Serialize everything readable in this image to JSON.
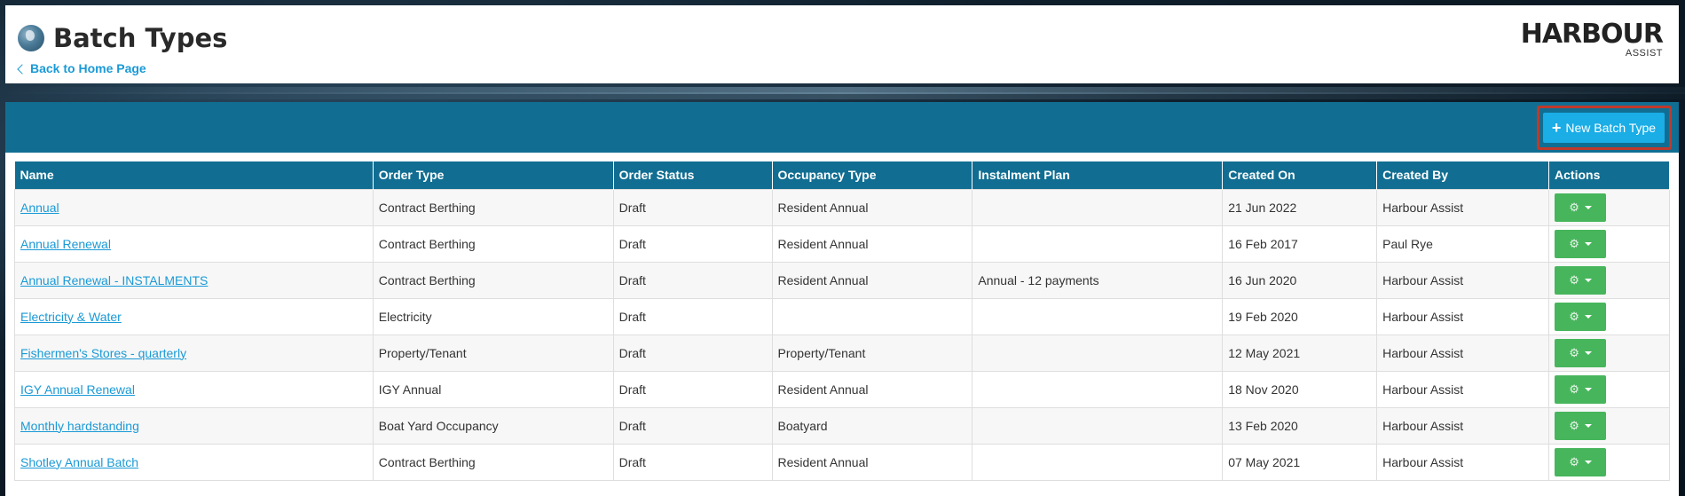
{
  "header": {
    "title": "Batch Types",
    "back_link": "Back to Home Page",
    "logo_main": "HARBOUR",
    "logo_sub": "ASSIST"
  },
  "toolbar": {
    "new_button_label": "New Batch Type"
  },
  "table": {
    "columns": [
      "Name",
      "Order Type",
      "Order Status",
      "Occupancy Type",
      "Instalment Plan",
      "Created On",
      "Created By",
      "Actions"
    ],
    "rows": [
      {
        "name": "Annual",
        "order_type": "Contract Berthing",
        "order_status": "Draft",
        "occupancy_type": "Resident Annual",
        "instalment_plan": "",
        "created_on": "21 Jun 2022",
        "created_by": "Harbour Assist"
      },
      {
        "name": "Annual Renewal",
        "order_type": "Contract Berthing",
        "order_status": "Draft",
        "occupancy_type": "Resident Annual",
        "instalment_plan": "",
        "created_on": "16 Feb 2017",
        "created_by": "Paul Rye"
      },
      {
        "name": "Annual Renewal - INSTALMENTS",
        "order_type": "Contract Berthing",
        "order_status": "Draft",
        "occupancy_type": "Resident Annual",
        "instalment_plan": "Annual - 12 payments",
        "created_on": "16 Jun 2020",
        "created_by": "Harbour Assist"
      },
      {
        "name": "Electricity & Water",
        "order_type": "Electricity",
        "order_status": "Draft",
        "occupancy_type": "",
        "instalment_plan": "",
        "created_on": "19 Feb 2020",
        "created_by": "Harbour Assist"
      },
      {
        "name": "Fishermen's Stores - quarterly",
        "order_type": "Property/Tenant",
        "order_status": "Draft",
        "occupancy_type": "Property/Tenant",
        "instalment_plan": "",
        "created_on": "12 May 2021",
        "created_by": "Harbour Assist"
      },
      {
        "name": "IGY Annual Renewal",
        "order_type": "IGY Annual",
        "order_status": "Draft",
        "occupancy_type": "Resident Annual",
        "instalment_plan": "",
        "created_on": "18 Nov 2020",
        "created_by": "Harbour Assist"
      },
      {
        "name": "Monthly hardstanding",
        "order_type": "Boat Yard Occupancy",
        "order_status": "Draft",
        "occupancy_type": "Boatyard",
        "instalment_plan": "",
        "created_on": "13 Feb 2020",
        "created_by": "Harbour Assist"
      },
      {
        "name": "Shotley Annual Batch",
        "order_type": "Contract Berthing",
        "order_status": "Draft",
        "occupancy_type": "Resident Annual",
        "instalment_plan": "",
        "created_on": "07 May 2021",
        "created_by": "Harbour Assist"
      }
    ]
  },
  "colors": {
    "primary": "#116e92",
    "accent": "#1aade6",
    "link": "#1a9ad6",
    "action": "#47b55c",
    "highlight": "#c0392b"
  },
  "icons": [
    "globe-icon",
    "chevron-left-icon",
    "plus-icon",
    "gears-icon",
    "caret-down-icon"
  ]
}
